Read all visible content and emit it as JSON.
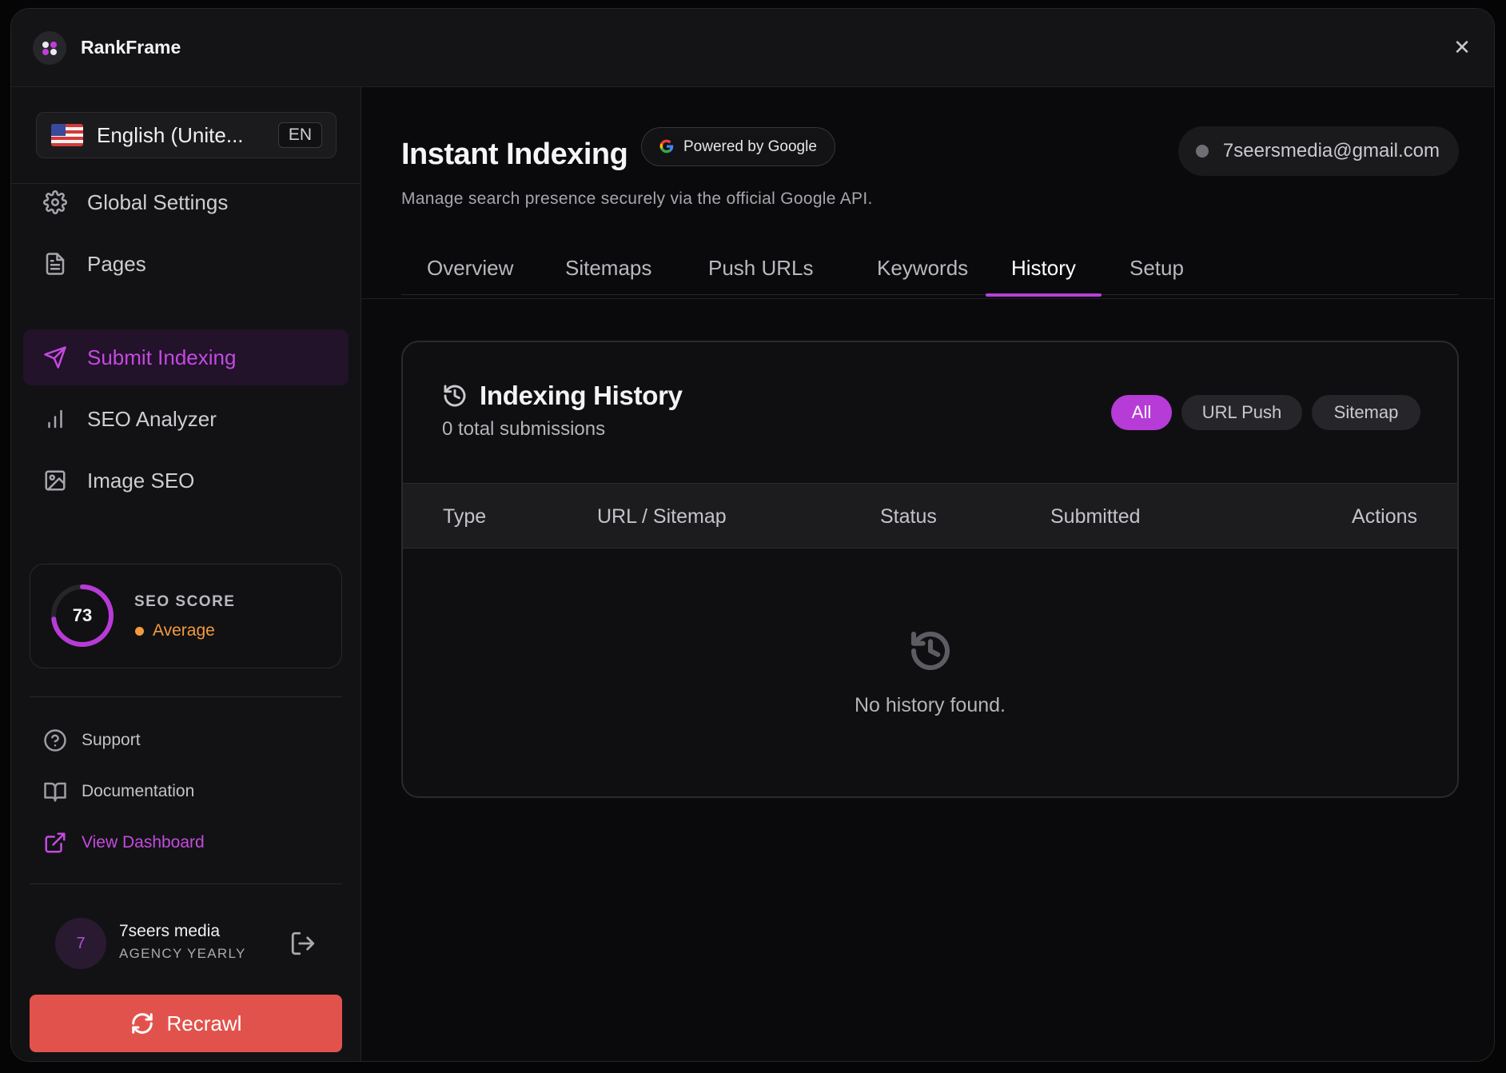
{
  "app": {
    "title": "RankFrame"
  },
  "language": {
    "label": "English (Unite...",
    "code": "EN"
  },
  "nav": [
    {
      "label": "Global Settings",
      "icon": "gear-icon"
    },
    {
      "label": "Pages",
      "icon": "document-icon"
    },
    {
      "label": "Submit Indexing",
      "icon": "send-icon",
      "active": true
    },
    {
      "label": "SEO Analyzer",
      "icon": "bar-chart-icon"
    },
    {
      "label": "Image SEO",
      "icon": "image-icon"
    }
  ],
  "seo_score": {
    "value": "73",
    "title": "SEO SCORE",
    "label": "Average",
    "fill_percent": 73,
    "ring_color": "#b73bd6",
    "label_color": "#f39a3f"
  },
  "links": [
    {
      "label": "Support",
      "icon": "help-circle-icon"
    },
    {
      "label": "Documentation",
      "icon": "book-icon"
    },
    {
      "label": "View Dashboard",
      "icon": "external-link-icon"
    }
  ],
  "user": {
    "initial": "7",
    "name": "7seers media",
    "plan": "AGENCY YEARLY"
  },
  "recrawl": {
    "label": "Recrawl"
  },
  "header": {
    "title": "Instant Indexing",
    "badge": "Powered by Google",
    "subtitle": "Manage search presence securely via the official Google API.",
    "account": "7seersmedia@gmail.com"
  },
  "tabs": [
    {
      "label": "Overview"
    },
    {
      "label": "Sitemaps"
    },
    {
      "label": "Push URLs"
    },
    {
      "label": "Keywords"
    },
    {
      "label": "History",
      "active": true
    },
    {
      "label": "Setup"
    }
  ],
  "history": {
    "title": "Indexing History",
    "count": "0 total submissions",
    "filters": [
      "All",
      "URL Push",
      "Sitemap"
    ],
    "columns": [
      "Type",
      "URL / Sitemap",
      "Status",
      "Submitted",
      "Actions"
    ],
    "empty": "No history found."
  },
  "colors": {
    "accent": "#b73bd6",
    "recrawl": "#e2524c",
    "warning": "#f39a3f"
  }
}
